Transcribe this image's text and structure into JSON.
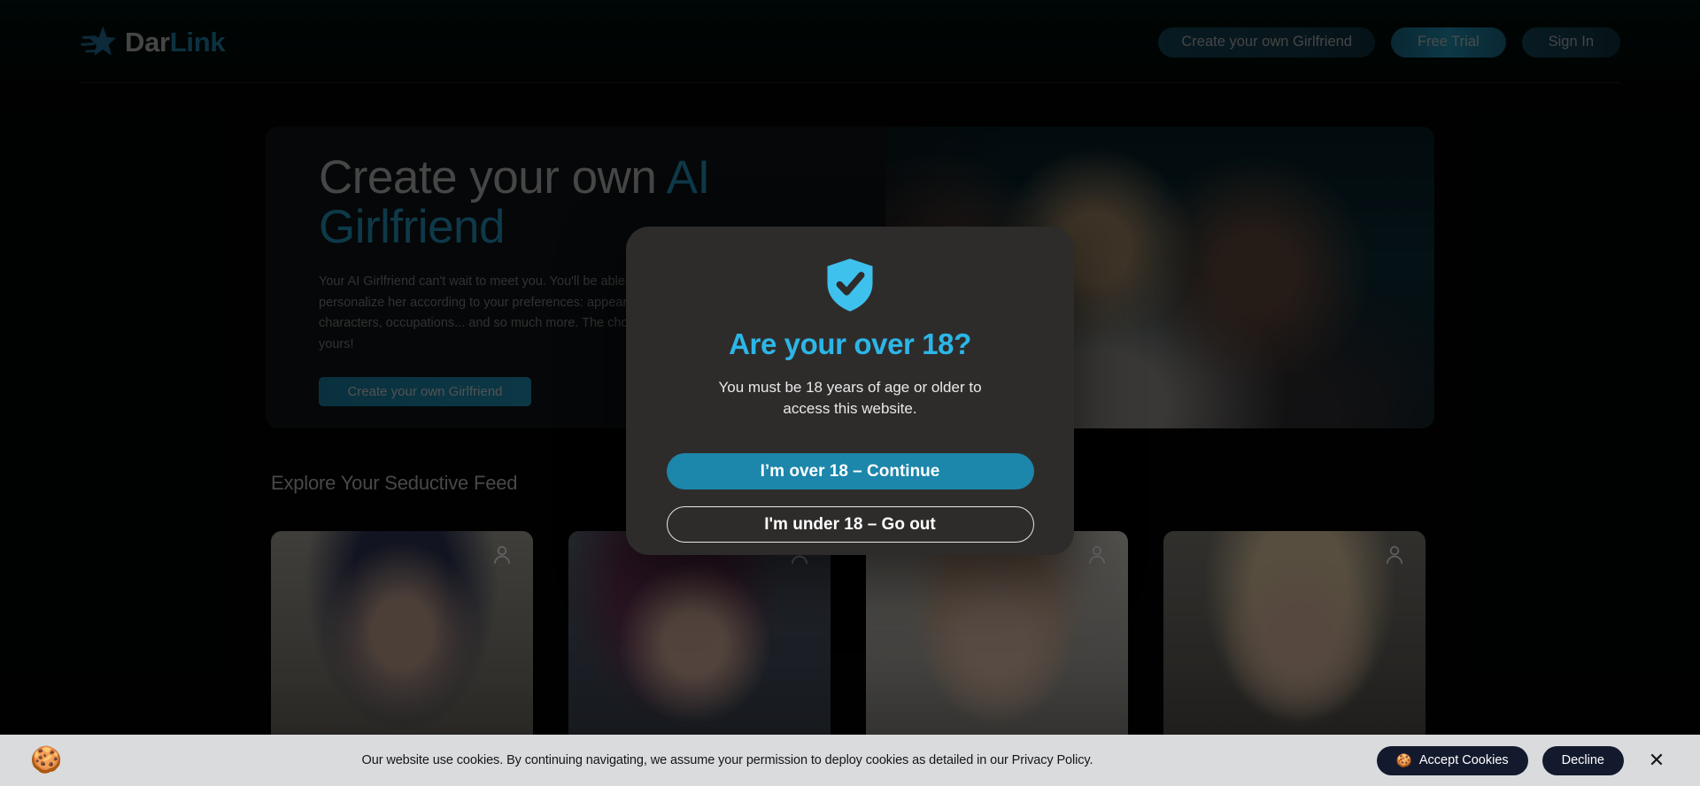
{
  "header": {
    "logo": {
      "icon": "star-icon",
      "text_primary": "Dar",
      "text_accent": "Link"
    },
    "nav": [
      {
        "name": "create-girlfriend-button",
        "label": "Create your own Girlfriend"
      },
      {
        "name": "free-trial-button",
        "label": "Free Trial"
      },
      {
        "name": "sign-in-button",
        "label": "Sign In"
      }
    ]
  },
  "hero": {
    "title_lead": "Create your own ",
    "title_accent": "AI Girlfriend",
    "description": "Your AI Girlfriend can't wait to meet you. You'll be able to personalize her according to your preferences: appearance, characters, occupations... and so much more. The choice is yours!",
    "cta_label": "Create your own Girlfriend"
  },
  "feed": {
    "title": "Explore Your Seductive Feed",
    "cards": [
      {
        "name": "feed-card-1",
        "avatar_icon": "person-icon"
      },
      {
        "name": "feed-card-2",
        "avatar_icon": "person-icon"
      },
      {
        "name": "feed-card-3",
        "avatar_icon": "person-icon"
      },
      {
        "name": "feed-card-4",
        "avatar_icon": "person-icon"
      }
    ]
  },
  "age_modal": {
    "icon": "shield-check-icon",
    "title": "Are your over 18?",
    "subtitle": "You must be 18 years of age or older to access this website.",
    "confirm_label": "I’m over 18 – Continue",
    "decline_label": "I'm under 18 – Go out"
  },
  "cookie_banner": {
    "emoji_icon": "cookie-icon",
    "text": "Our website use cookies. By continuing navigating, we assume your permission to deploy cookies as detailed in our Privacy Policy.",
    "accept_label": "Accept Cookies",
    "accept_icon": "cookie-icon",
    "decline_label": "Decline",
    "close_label": "✕"
  },
  "colors": {
    "accent_cyan": "#2cb6e8",
    "accent_teal": "#1c86ab",
    "logo_accent": "#1c6e91",
    "modal_bg": "#2e2c2b",
    "page_bg": "#010302",
    "cookie_bar_bg": "#d9dbdd",
    "cookie_btn_bg": "#141a2e"
  }
}
